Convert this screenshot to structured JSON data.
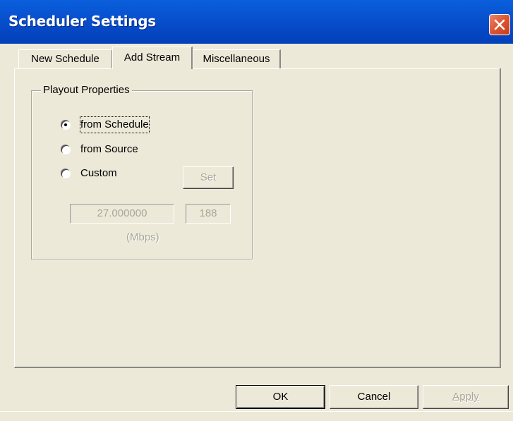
{
  "window": {
    "title": "Scheduler Settings",
    "close_icon": "close-x-icon"
  },
  "tabs": [
    {
      "label": "New Schedule",
      "active": false
    },
    {
      "label": "Add Stream",
      "active": true
    },
    {
      "label": "Miscellaneous",
      "active": false
    }
  ],
  "playout": {
    "group_label": "Playout Properties",
    "options": [
      {
        "label": "from Schedule",
        "selected": true
      },
      {
        "label": "from Source",
        "selected": false
      },
      {
        "label": "Custom",
        "selected": false
      }
    ],
    "set_button": "Set",
    "rate_value": "27.000000",
    "packet_value": "188",
    "unit_label": "(Mbps)"
  },
  "footer": {
    "ok": "OK",
    "cancel": "Cancel",
    "apply": "Apply"
  },
  "colors": {
    "titlebar": "#0547c4",
    "face": "#ece9d8",
    "disabled_text": "#a9a79b"
  }
}
